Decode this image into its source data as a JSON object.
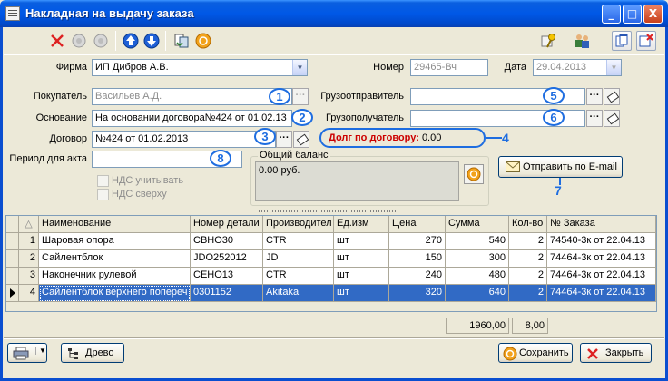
{
  "window": {
    "title": "Накладная на выдачу заказа"
  },
  "caption_buttons": {
    "minimize": "_",
    "maximize": "□",
    "close": "X"
  },
  "form": {
    "firm_label": "Фирма",
    "firm_value": "ИП Дибров А.В.",
    "number_label": "Номер",
    "number_value": "29465-Вч",
    "date_label": "Дата",
    "date_value": "29.04.2013",
    "buyer_label": "Покупатель",
    "buyer_value": "Васильев А.Д.",
    "basis_label": "Основание",
    "basis_value": "На основании договора№424 от 01.02.13",
    "contract_label": "Договор",
    "contract_value": "№424 от 01.02.2013",
    "period_label": "Период для акта",
    "period_value": "",
    "shipper_label": "Грузоотправитель",
    "shipper_value": "",
    "consignee_label": "Грузополучатель",
    "consignee_value": "",
    "debt_label": "Долг по договору:",
    "debt_value": "0.00",
    "vat_include_label": "НДС учитывать",
    "vat_top_label": "НДС сверху",
    "balance_title": "Общий баланс",
    "balance_value": "0.00 руб.",
    "email_button": "Отправить по E-mail",
    "ellipsis": "···"
  },
  "annotations": [
    "1",
    "2",
    "3",
    "4",
    "5",
    "6",
    "7",
    "8"
  ],
  "grid": {
    "sort_glyph": "△",
    "columns": [
      "Наименование",
      "Номер детали",
      "Производител",
      "Ед.изм",
      "Цена",
      "Сумма",
      "Кол-во",
      "№ Заказа"
    ],
    "rows": [
      {
        "n": "1",
        "name": "Шаровая опора",
        "part": "CBHO30",
        "maker": "CTR",
        "unit": "шт",
        "price": "270",
        "sum": "540",
        "qty": "2",
        "order": "74540-3к от 22.04.13"
      },
      {
        "n": "2",
        "name": "Сайлентблок",
        "part": "JDO252012",
        "maker": "JD",
        "unit": "шт",
        "price": "150",
        "sum": "300",
        "qty": "2",
        "order": "74464-3к от 22.04.13"
      },
      {
        "n": "3",
        "name": "Наконечник рулевой",
        "part": "CEHO13",
        "maker": "CTR",
        "unit": "шт",
        "price": "240",
        "sum": "480",
        "qty": "2",
        "order": "74464-3к от 22.04.13"
      },
      {
        "n": "4",
        "name": "Сайлентблок верхнего попереч",
        "part": "0301152",
        "maker": "Akitaka",
        "unit": "шт",
        "price": "320",
        "sum": "640",
        "qty": "2",
        "order": "74464-3к от 22.04.13"
      }
    ],
    "total_sum": "1960,00",
    "total_qty": "8,00"
  },
  "bottom": {
    "tree_button": "Древо",
    "save_button": "Сохранить",
    "close_button": "Закрыть"
  },
  "colors": {
    "titlebar": "#0058e6",
    "selection": "#316ac5",
    "annotation": "#1e6de0",
    "debt_text": "#cc0000"
  }
}
